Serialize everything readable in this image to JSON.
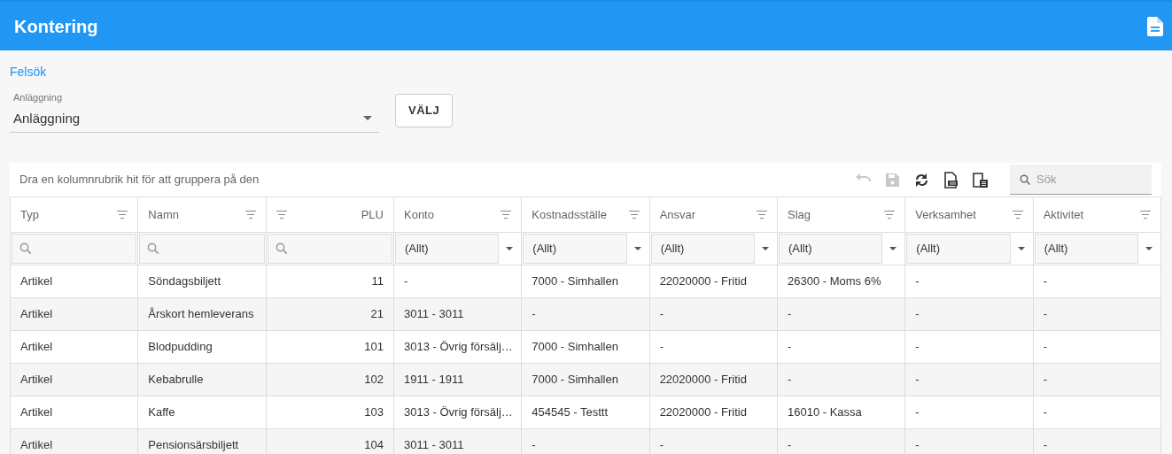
{
  "app_bar": {
    "title": "Kontering"
  },
  "link": "Felsök",
  "select": {
    "label": "Anläggning",
    "value": "Anläggning"
  },
  "choose_button": "VÄLJ",
  "grid": {
    "group_hint": "Dra en kolumnrubrik hit för att gruppera på den",
    "toolbar": [
      {
        "kind": "undo",
        "disabled": true
      },
      {
        "kind": "save",
        "disabled": true
      },
      {
        "kind": "refresh",
        "disabled": false
      },
      {
        "kind": "export",
        "disabled": false
      },
      {
        "kind": "columns",
        "disabled": false
      }
    ],
    "search": {
      "placeholder": "Sök"
    },
    "columns": [
      {
        "title": "Typ",
        "kind": "text",
        "filter": {
          "kind": "search"
        }
      },
      {
        "title": "Namn",
        "kind": "text",
        "filter": {
          "kind": "search"
        }
      },
      {
        "title": "PLU",
        "kind": "number",
        "filter": {
          "kind": "search"
        }
      },
      {
        "title": "Konto",
        "kind": "text",
        "filter": {
          "kind": "select",
          "value": "(Allt)"
        }
      },
      {
        "title": "Kostnadsställe",
        "kind": "text",
        "filter": {
          "kind": "select",
          "value": "(Allt)"
        }
      },
      {
        "title": "Ansvar",
        "kind": "text",
        "filter": {
          "kind": "select",
          "value": "(Allt)"
        }
      },
      {
        "title": "Slag",
        "kind": "text",
        "filter": {
          "kind": "select",
          "value": "(Allt)"
        }
      },
      {
        "title": "Verksamhet",
        "kind": "text",
        "filter": {
          "kind": "select",
          "value": "(Allt)"
        }
      },
      {
        "title": "Aktivitet",
        "kind": "text",
        "filter": {
          "kind": "select",
          "value": "(Allt)"
        }
      }
    ],
    "rows": [
      [
        "Artikel",
        "Söndagsbiljett",
        "11",
        "-",
        "7000 - Simhallen",
        "22020000 - Fritid",
        "26300 - Moms 6%",
        "-",
        "-"
      ],
      [
        "Artikel",
        "Årskort hemleverans",
        "21",
        "3011 - 3011",
        "-",
        "-",
        "-",
        "-",
        "-"
      ],
      [
        "Artikel",
        "Blodpudding",
        "101",
        "3013 - Övrig försälj…",
        "7000 - Simhallen",
        "-",
        "-",
        "-",
        "-"
      ],
      [
        "Artikel",
        "Kebabrulle",
        "102",
        "1911 - 1911",
        "7000 - Simhallen",
        "22020000 - Fritid",
        "-",
        "-",
        "-"
      ],
      [
        "Artikel",
        "Kaffe",
        "103",
        "3013 - Övrig försälj…",
        "454545 - Testtt",
        "22020000 - Fritid",
        "16010 - Kassa",
        "-",
        "-"
      ],
      [
        "Artikel",
        "Pensionsärsbiljett",
        "104",
        "3011 - 3011",
        "-",
        "-",
        "-",
        "-",
        "-"
      ]
    ]
  }
}
